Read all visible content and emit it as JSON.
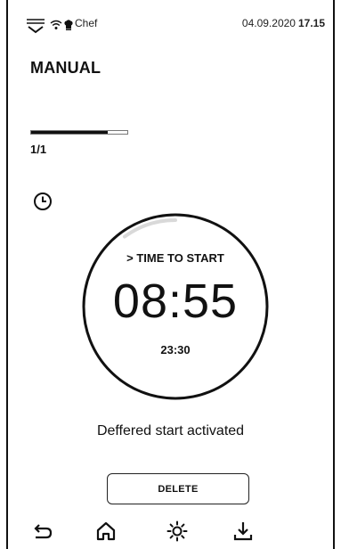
{
  "status_bar": {
    "menu_icon": "dropdown-menu-icon",
    "wifi_icon": "wifi-icon",
    "profile_icon": "chef-hat-icon",
    "profile_name": "Chef",
    "date": "04.09.2020",
    "time": "17.15"
  },
  "page": {
    "title": "MANUAL"
  },
  "step": {
    "counter": "1/1",
    "progress": 0.8
  },
  "timer": {
    "icon": "clock-icon",
    "label": "> TIME TO START",
    "countdown": "08:55",
    "end_time": "23:30",
    "ring_progress": 0.1
  },
  "message": "Deffered start activated",
  "delete_label": "DELETE",
  "nav": {
    "back_icon": "back-arrow-icon",
    "home_icon": "home-icon",
    "light_icon": "light-icon",
    "download_icon": "download-icon"
  },
  "colors": {
    "foreground": "#111111",
    "background": "#ffffff",
    "ring_track": "#d9d9d9"
  }
}
